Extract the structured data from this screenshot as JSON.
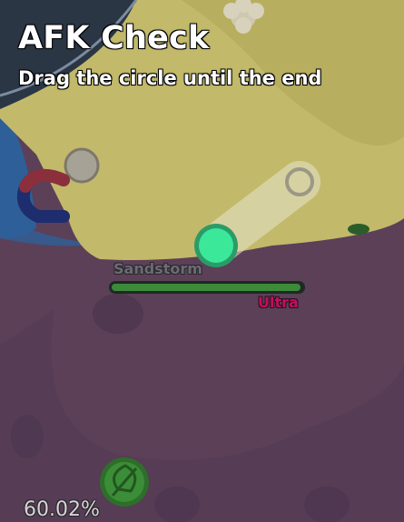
{
  "afk_check": {
    "title": "AFK Check",
    "instruction": "Drag the circle until the end",
    "handle_color": "#3be89a",
    "track_color": "#e7e6cf"
  },
  "mob": {
    "name": "Sandstorm",
    "rarity": "Ultra",
    "rarity_color": "#c0105a",
    "health_fraction": 0.99
  },
  "hud": {
    "progress_text": "60.02%"
  },
  "colors": {
    "ground": "#5b4058",
    "desert": "#c2b96a",
    "water": "#2f5f98"
  },
  "icons": [
    "leaf-petal-icon",
    "cloud-petal-icon",
    "basic-petal-icon",
    "magnet-icon"
  ]
}
